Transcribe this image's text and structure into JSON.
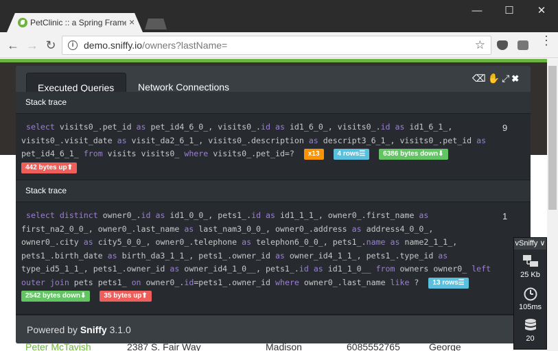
{
  "browser": {
    "tab_title": "PetClinic :: a Spring Framework",
    "tab_close": "×",
    "url_host": "demo.sniffy.io",
    "url_path": "/owners?lastName=",
    "window_controls": {
      "minimize": "—",
      "maximize": "☐",
      "close": "✕"
    },
    "nav": {
      "back": "←",
      "forward": "→",
      "reload": "↻"
    }
  },
  "sniffy": {
    "tabs": [
      "Executed Queries",
      "Network Connections"
    ],
    "tools": "⌫✋⤢✖",
    "stack_trace_label": "Stack trace",
    "queries": [
      {
        "lines": [
          [
            [
              "kw",
              "select"
            ],
            [
              "t",
              " visits0_.pet_id "
            ],
            [
              "kw",
              "as"
            ],
            [
              "t",
              " pet_id4_6_0_, visits0_."
            ],
            [
              "kw",
              "id"
            ],
            [
              "t",
              " "
            ],
            [
              "kw",
              "as"
            ],
            [
              "t",
              " id1_6_0_, visits0_."
            ],
            [
              "kw",
              "id"
            ],
            [
              "t",
              " "
            ],
            [
              "kw",
              "as"
            ],
            [
              "t",
              " id1_6_1_,"
            ]
          ],
          [
            [
              "t",
              "visits0_.visit_date "
            ],
            [
              "kw",
              "as"
            ],
            [
              "t",
              " visit_da2_6_1_, visits0_.description "
            ],
            [
              "kw",
              "as"
            ],
            [
              "t",
              " descript3_6_1_, visits0_.pet_id "
            ],
            [
              "kw",
              "as"
            ]
          ],
          [
            [
              "t",
              "pet_id4_6_1_ "
            ],
            [
              "kw",
              "from"
            ],
            [
              "t",
              " visits visits0_ "
            ],
            [
              "kw",
              "where"
            ],
            [
              "t",
              " visits0_.pet_id=? "
            ]
          ]
        ],
        "count": "9",
        "badges": [
          {
            "text": "x13",
            "color": "orange"
          },
          {
            "text": "4 rows☰",
            "color": "blue"
          },
          {
            "text": "6386 bytes down⬇",
            "color": "green"
          },
          {
            "text": "442 bytes up⬆",
            "color": "red"
          }
        ]
      },
      {
        "lines": [
          [
            [
              "kw",
              "select"
            ],
            [
              "t",
              " "
            ],
            [
              "kw",
              "distinct"
            ],
            [
              "t",
              " owner0_."
            ],
            [
              "kw",
              "id"
            ],
            [
              "t",
              " "
            ],
            [
              "kw",
              "as"
            ],
            [
              "t",
              " id1_0_0_, pets1_."
            ],
            [
              "kw",
              "id"
            ],
            [
              "t",
              " "
            ],
            [
              "kw",
              "as"
            ],
            [
              "t",
              " id1_1_1_, owner0_.first_name "
            ],
            [
              "kw",
              "as"
            ]
          ],
          [
            [
              "t",
              "first_na2_0_0_, owner0_.last_name "
            ],
            [
              "kw",
              "as"
            ],
            [
              "t",
              " last_nam3_0_0_, owner0_.address "
            ],
            [
              "kw",
              "as"
            ],
            [
              "t",
              " address4_0_0_,"
            ]
          ],
          [
            [
              "t",
              "owner0_.city "
            ],
            [
              "kw",
              "as"
            ],
            [
              "t",
              " city5_0_0_, owner0_.telephone "
            ],
            [
              "kw",
              "as"
            ],
            [
              "t",
              " telephon6_0_0_, pets1_."
            ],
            [
              "kw",
              "name"
            ],
            [
              "t",
              " "
            ],
            [
              "kw",
              "as"
            ],
            [
              "t",
              " name2_1_1_,"
            ]
          ],
          [
            [
              "t",
              "pets1_.birth_date "
            ],
            [
              "kw",
              "as"
            ],
            [
              "t",
              " birth_da3_1_1_, pets1_.owner_id "
            ],
            [
              "kw",
              "as"
            ],
            [
              "t",
              " owner_id4_1_1_, pets1_.type_id "
            ],
            [
              "kw",
              "as"
            ]
          ],
          [
            [
              "t",
              "type_id5_1_1_, pets1_.owner_id "
            ],
            [
              "kw",
              "as"
            ],
            [
              "t",
              " owner_id4_1_0__, pets1_."
            ],
            [
              "kw",
              "id"
            ],
            [
              "t",
              " "
            ],
            [
              "kw",
              "as"
            ],
            [
              "t",
              " id1_1_0__ "
            ],
            [
              "kw",
              "from"
            ],
            [
              "t",
              " owners owner0_ "
            ],
            [
              "kw",
              "left"
            ]
          ],
          [
            [
              "kw",
              "outer"
            ],
            [
              "t",
              " "
            ],
            [
              "kw",
              "join"
            ],
            [
              "t",
              " pets pets1_ "
            ],
            [
              "kw",
              "on"
            ],
            [
              "t",
              " owner0_."
            ],
            [
              "kw",
              "id"
            ],
            [
              "t",
              "=pets1_.owner_id "
            ],
            [
              "kw",
              "where"
            ],
            [
              "t",
              " owner0_.last_name "
            ],
            [
              "kw",
              "like"
            ],
            [
              "t",
              " ? "
            ]
          ]
        ],
        "count": "1",
        "badges": [
          {
            "text": "13 rows☰",
            "color": "blue"
          },
          {
            "text": "2542 bytes down⬇",
            "color": "green"
          },
          {
            "text": "35 bytes up⬆",
            "color": "red"
          }
        ]
      }
    ],
    "footer_prefix": "Powered by ",
    "footer_brand": "Sniffy",
    "footer_version": " 3.1.0"
  },
  "vsniffy": {
    "title": "vSniffy ∨",
    "network": "25 Kb",
    "time": "105ms",
    "queries": "20"
  },
  "background_row": {
    "name": "Peter McTavish",
    "address": "2387 S. Fair Way",
    "city": "Madison",
    "telephone": "6085552765",
    "pets": "George"
  }
}
